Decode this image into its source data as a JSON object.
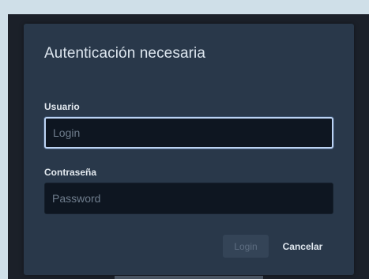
{
  "dialog": {
    "title": "Autenticación necesaria",
    "username": {
      "label": "Usuario",
      "placeholder": "Login",
      "value": ""
    },
    "password": {
      "label": "Contraseña",
      "placeholder": "Password",
      "value": ""
    },
    "buttons": {
      "login_label": "Login",
      "cancel_label": "Cancelar"
    }
  },
  "colors": {
    "page_background": "#cfdfe8",
    "backdrop": "#1b2029",
    "dialog_background": "#29384a",
    "input_background": "#0e1621",
    "focus_border": "#bcd3f3",
    "disabled_button": "#344457"
  }
}
